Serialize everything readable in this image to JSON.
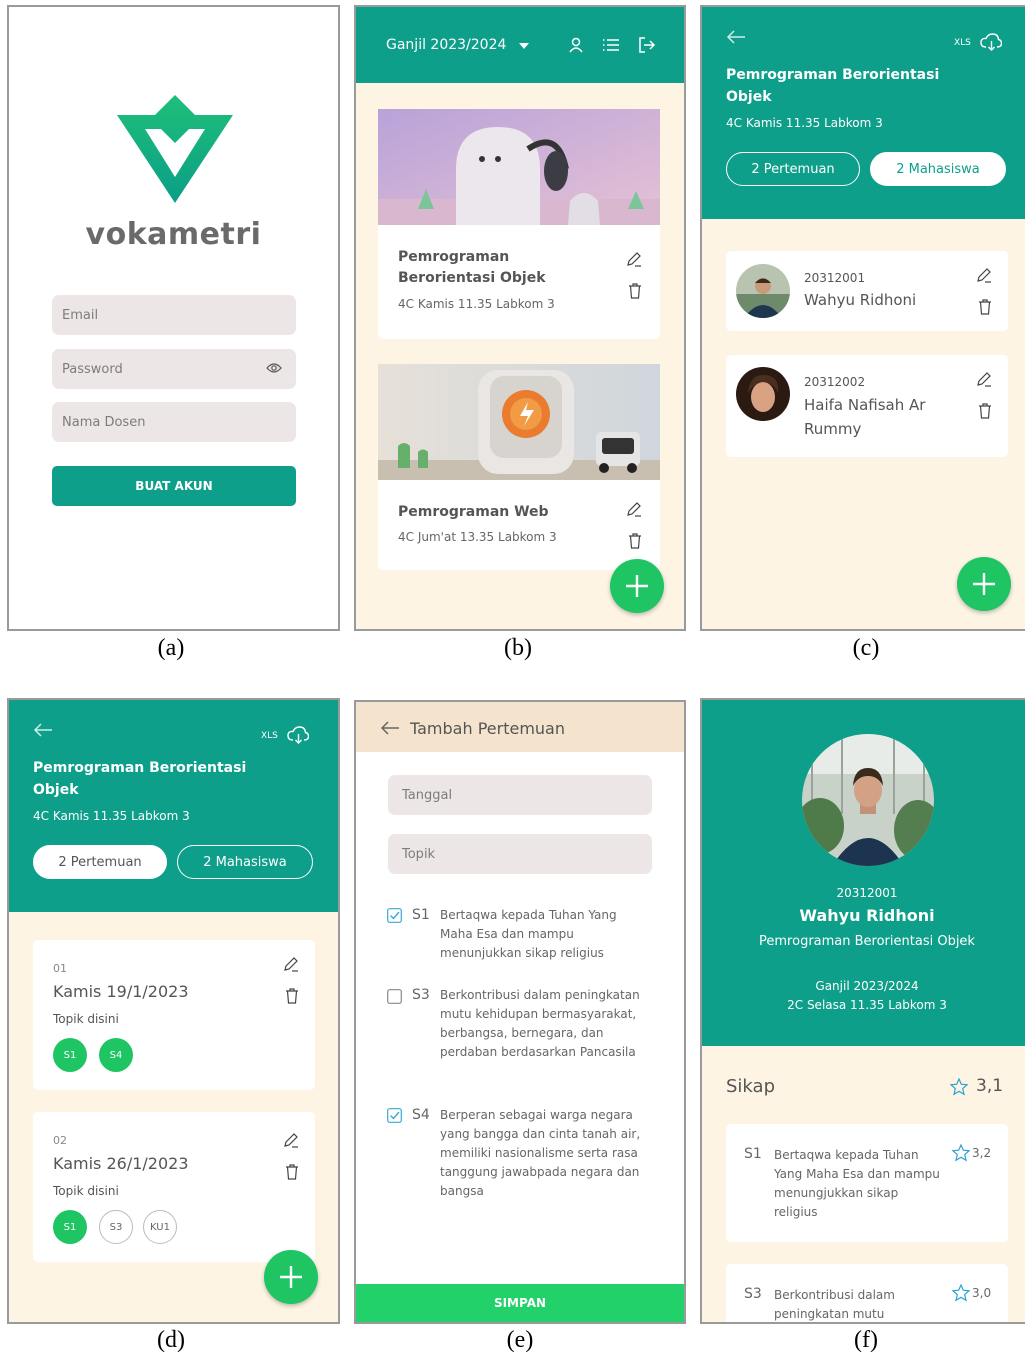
{
  "colors": {
    "teal": "#0e9f8a",
    "green": "#1fc563",
    "cream": "#fdf4e4",
    "field": "#ede6e6"
  },
  "captions": [
    "(a)",
    "(b)",
    "(c)",
    "(d)",
    "(e)",
    "(f)"
  ],
  "a": {
    "logo_text": "vokametri",
    "email_placeholder": "Email",
    "password_placeholder": "Password",
    "name_placeholder": "Nama Dosen",
    "submit_label": "BUAT AKUN"
  },
  "b": {
    "semester": "Ganjil 2023/2024",
    "courses": [
      {
        "title": "Pemrograman Berorientasi Objek",
        "detail": "4C Kamis 11.35 Labkom 3"
      },
      {
        "title": "Pemrograman Web",
        "detail": "4C Jum'at 13.35 Labkom 3"
      }
    ]
  },
  "c": {
    "xls_label": "XLS",
    "course_title": "Pemrograman Berorientasi Objek",
    "course_detail": "4C Kamis 11.35 Labkom 3",
    "tab_meetings": "2 Pertemuan",
    "tab_students": "2 Mahasiswa",
    "students": [
      {
        "nim": "20312001",
        "name": "Wahyu Ridhoni"
      },
      {
        "nim": "20312002",
        "name": "Haifa Nafisah Ar Rummy"
      }
    ]
  },
  "d": {
    "xls_label": "XLS",
    "course_title": "Pemrograman Berorientasi Objek",
    "course_detail": "4C Kamis 11.35 Labkom 3",
    "tab_meetings": "2 Pertemuan",
    "tab_students": "2 Mahasiswa",
    "meetings": [
      {
        "number": "01",
        "date": "Kamis 19/1/2023",
        "topic": "Topik disini",
        "tags": [
          "S1",
          "S4"
        ]
      },
      {
        "number": "02",
        "date": "Kamis 26/1/2023",
        "topic": "Topik disini",
        "tags": [
          "S1",
          "S3",
          "KU1"
        ]
      }
    ]
  },
  "e": {
    "header_title": "Tambah Pertemuan",
    "date_placeholder": "Tanggal",
    "topic_placeholder": "Topik",
    "items": [
      {
        "code": "S1",
        "text": "Bertaqwa kepada Tuhan Yang Maha Esa dan mampu menunjukkan sikap religius",
        "checked": true
      },
      {
        "code": "S3",
        "text": "Berkontribusi dalam peningkatan mutu kehidupan bermasyarakat, berbangsa, bernegara, dan perdaban berdasarkan Pancasila",
        "checked": false
      },
      {
        "code": "S4",
        "text": "Berperan sebagai warga negara yang bangga dan cinta tanah air, memiliki nasionalisme serta rasa tanggung jawabpada negara dan bangsa",
        "checked": true
      }
    ],
    "save_label": "SIMPAN"
  },
  "f": {
    "nim": "20312001",
    "name": "Wahyu Ridhoni",
    "course": "Pemrograman Berorientasi Objek",
    "semester": "Ganjil 2023/2024",
    "class_detail": "2C Selasa 11.35 Labkom 3",
    "section_title": "Sikap",
    "section_score": "3,1",
    "items": [
      {
        "code": "S1",
        "text": "Bertaqwa kepada Tuhan Yang Maha Esa dan mampu menungjukkan sikap religius",
        "score": "3,2"
      },
      {
        "code": "S3",
        "text": "Berkontribusi dalam peningkatan mutu",
        "score": "3,0"
      }
    ]
  }
}
